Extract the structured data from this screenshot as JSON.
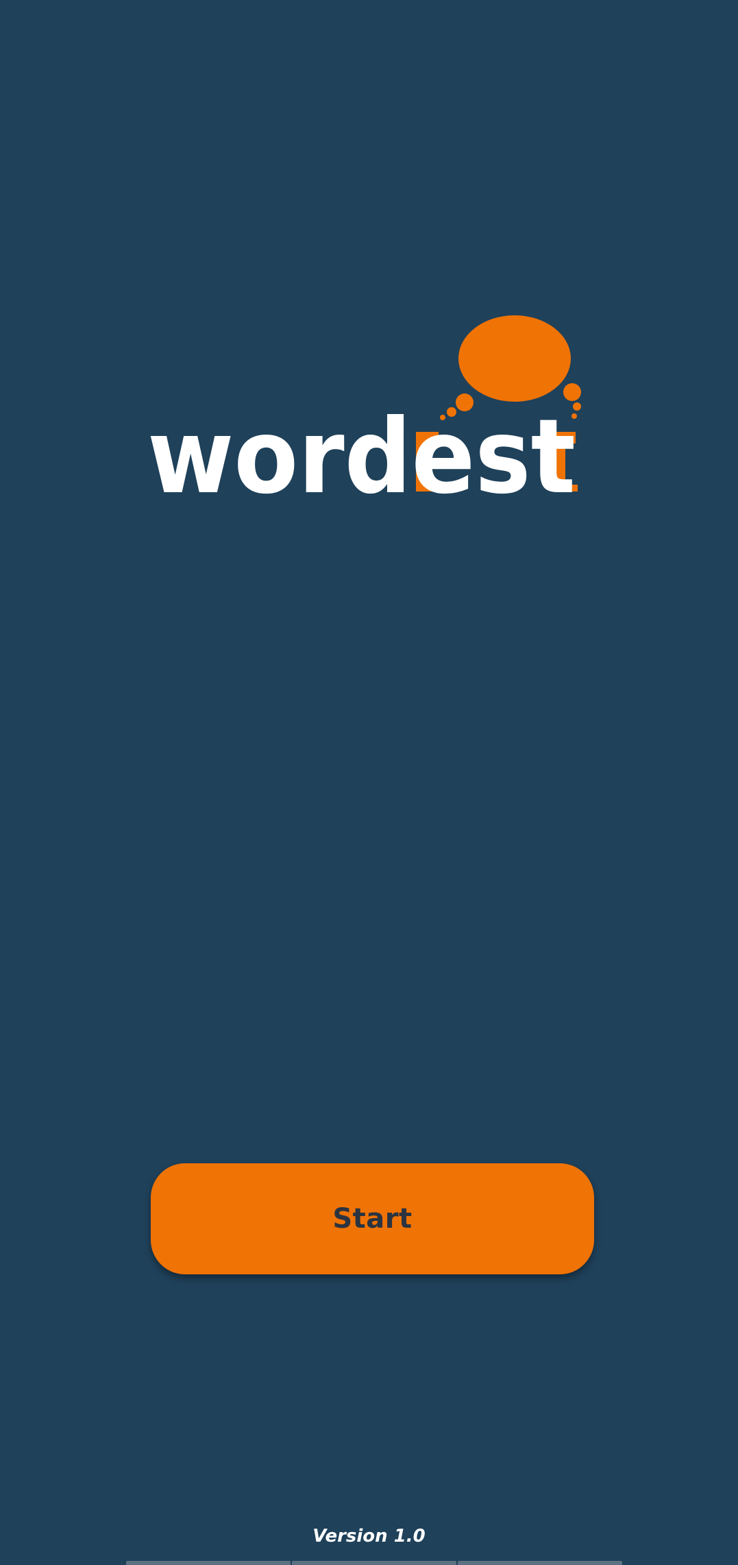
{
  "app": {
    "logo_text": "wordest",
    "colors": {
      "background": "#1f415a",
      "accent": "#f07306",
      "text_on_accent": "#2b3440",
      "logo_text": "#ffffff"
    }
  },
  "main": {
    "start_label": "Start"
  },
  "footer": {
    "version": "Version 1.0"
  }
}
